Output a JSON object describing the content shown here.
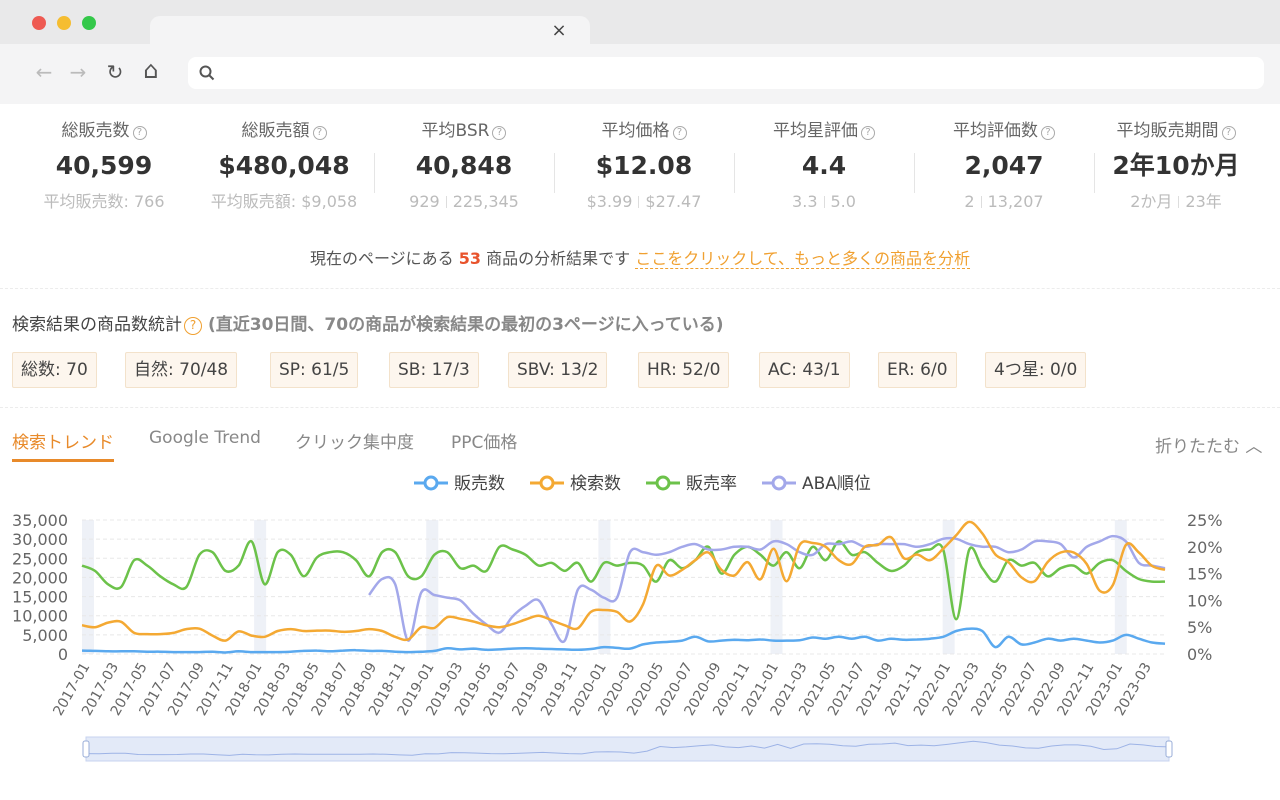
{
  "browser": {
    "tab_close": "×",
    "nav": {
      "back": "←",
      "forward": "→",
      "reload": "↻",
      "home": "⌂"
    }
  },
  "stats": [
    {
      "label": "総販売数",
      "value": "40,599",
      "sub": [
        "平均販売数: 766"
      ]
    },
    {
      "label": "総販売額",
      "value": "$480,048",
      "sub": [
        "平均販売額: $9,058"
      ]
    },
    {
      "label": "平均BSR",
      "value": "40,848",
      "sub": [
        "929",
        "225,345"
      ]
    },
    {
      "label": "平均価格",
      "value": "$12.08",
      "sub": [
        "$3.99",
        "$27.47"
      ]
    },
    {
      "label": "平均星評価",
      "value": "4.4",
      "sub": [
        "3.3",
        "5.0"
      ]
    },
    {
      "label": "平均評価数",
      "value": "2,047",
      "sub": [
        "2",
        "13,207"
      ]
    },
    {
      "label": "平均販売期間",
      "value": "2年10か月",
      "sub": [
        "2か月",
        "23年"
      ]
    }
  ],
  "question_mark": "?",
  "summary": {
    "prefix": "現在のページにある",
    "count": "53",
    "suffix": "商品の分析結果です",
    "link": "ここをクリックして、もっと多くの商品を分析"
  },
  "search_stats": {
    "title": "検索結果の商品数統計",
    "note": "(直近30日間、70の商品が検索結果の最初の3ページに入っている)",
    "chips": [
      "総数: 70",
      "自然: 70/48",
      "SP: 61/5",
      "SB: 17/3",
      "SBV: 13/2",
      "HR: 52/0",
      "AC: 43/1",
      "ER: 6/0",
      "4つ星: 0/0"
    ]
  },
  "tabs": [
    "検索トレンド",
    "Google Trend",
    "クリック集中度",
    "PPC価格"
  ],
  "fold_label": "折りたたむ ︿",
  "colors": {
    "sales": "#5aa9ef",
    "search": "#f4a933",
    "rate": "#6cc24a",
    "aba": "#a3a8ea",
    "accent": "#e88a2a"
  },
  "chart_data": {
    "type": "line",
    "series": [
      {
        "name": "販売数",
        "axis": "left"
      },
      {
        "name": "検索数",
        "axis": "left"
      },
      {
        "name": "販売率",
        "axis": "right"
      },
      {
        "name": "ABA順位",
        "axis": "right"
      }
    ],
    "x_ticks": [
      "2017-01",
      "2017-03",
      "2017-05",
      "2017-07",
      "2017-09",
      "2017-11",
      "2018-01",
      "2018-03",
      "2018-05",
      "2018-07",
      "2018-09",
      "2018-11",
      "2019-01",
      "2019-03",
      "2019-05",
      "2019-07",
      "2019-09",
      "2019-11",
      "2020-01",
      "2020-03",
      "2020-05",
      "2020-07",
      "2020-09",
      "2020-11",
      "2021-01",
      "2021-03",
      "2021-05",
      "2021-07",
      "2021-09",
      "2021-11",
      "2022-01",
      "2022-03",
      "2022-05",
      "2022-07",
      "2022-09",
      "2022-11",
      "2023-01",
      "2023-03"
    ],
    "y_left_ticks": [
      "0",
      "5,000",
      "10,000",
      "15,000",
      "20,000",
      "25,000",
      "30,000",
      "35,000"
    ],
    "y_left_range": [
      0,
      35000
    ],
    "y_right_ticks": [
      "0%",
      "5%",
      "10%",
      "15%",
      "20%",
      "25%"
    ],
    "y_right_range": [
      0,
      25
    ],
    "sales": [
      900,
      800,
      700,
      700,
      700,
      600,
      600,
      500,
      500,
      500,
      600,
      400,
      700,
      500,
      500,
      500,
      600,
      800,
      900,
      700,
      900,
      1000,
      800,
      800,
      600,
      500,
      600,
      800,
      1500,
      1200,
      1400,
      1100,
      1200,
      1400,
      1500,
      1400,
      1300,
      1200,
      1100,
      1300,
      1800,
      1600,
      1400,
      2500,
      3000,
      3200,
      3500,
      4500,
      3300,
      3500,
      3700,
      3600,
      3800,
      3500,
      3500,
      3600,
      4300,
      4000,
      4500,
      4000,
      4500,
      3500,
      4000,
      3700,
      3800,
      4000,
      4500,
      6000,
      6600,
      6000,
      1800,
      4500,
      2500,
      3000,
      4000,
      3500,
      4000,
      3500,
      3000,
      3500,
      5000,
      4000,
      3000,
      2700
    ],
    "search": [
      7500,
      7000,
      8200,
      8400,
      5500,
      5200,
      5200,
      5500,
      6500,
      6600,
      4800,
      3500,
      5900,
      4800,
      4500,
      6000,
      6500,
      6000,
      6100,
      6100,
      5800,
      6000,
      6500,
      6000,
      4500,
      3800,
      7000,
      6800,
      9600,
      9200,
      8500,
      7500,
      7000,
      7800,
      9000,
      10000,
      8800,
      7500,
      6700,
      11000,
      11500,
      11000,
      8500,
      13000,
      23000,
      20500,
      22000,
      24500,
      26500,
      22000,
      20500,
      24000,
      19500,
      27500,
      19000,
      28500,
      29000,
      28000,
      24500,
      23500,
      28000,
      28500,
      30500,
      25000,
      26000,
      24500,
      27500,
      31000,
      34500,
      31500,
      26000,
      24000,
      20000,
      19000,
      24000,
      26500,
      26500,
      23500,
      16500,
      18000,
      28500,
      26500,
      23000,
      22000
    ],
    "rate": [
      16.5,
      15.5,
      13,
      12.5,
      17.5,
      16.5,
      14.5,
      13,
      12.5,
      18.5,
      19,
      15.5,
      16.5,
      21,
      13,
      19,
      18.5,
      14.5,
      18,
      19,
      19,
      17.5,
      14.5,
      19,
      19,
      14.5,
      14.5,
      18.5,
      19,
      16,
      16.5,
      15.5,
      20,
      19.5,
      18.5,
      16.5,
      17,
      15.5,
      17,
      13.5,
      17,
      16.5,
      17,
      16.5,
      13.5,
      17.5,
      16,
      17.5,
      20,
      15,
      18.5,
      20,
      18.5,
      16.5,
      19,
      16,
      20,
      17.5,
      21,
      18.5,
      19,
      17,
      15.5,
      16.5,
      19,
      19.5,
      19.5,
      6.5,
      19.5,
      16,
      13.5,
      17.5,
      16.5,
      17,
      14.5,
      16,
      16.5,
      15,
      17,
      17.5,
      15.5,
      14,
      13.5,
      13.5
    ],
    "aba": [
      null,
      null,
      null,
      null,
      null,
      null,
      null,
      null,
      null,
      null,
      null,
      null,
      null,
      null,
      null,
      null,
      null,
      null,
      null,
      null,
      null,
      null,
      11,
      14,
      13,
      2.5,
      11.5,
      11,
      10.5,
      10,
      7.5,
      5.5,
      4,
      7,
      9,
      10,
      5.5,
      2.5,
      12,
      12,
      10.5,
      10.5,
      19,
      19,
      18.5,
      19,
      20,
      20.5,
      19.5,
      19.5,
      20,
      20,
      19.5,
      21,
      20.5,
      19,
      18.5,
      20.5,
      20.5,
      21,
      20,
      20.5,
      20.5,
      20.5,
      20,
      20.5,
      21.5,
      21.5,
      20.5,
      20,
      20,
      19,
      19.5,
      21,
      21,
      20.5,
      18,
      20,
      21,
      22,
      21,
      17,
      16.5,
      16
    ]
  }
}
